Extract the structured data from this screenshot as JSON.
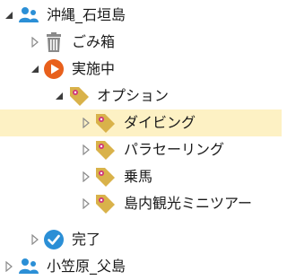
{
  "tree": {
    "nodes": [
      {
        "label": "沖縄_石垣島",
        "icon": "user-group-icon",
        "expanded": true,
        "selected": false
      },
      {
        "label": "ごみ箱",
        "icon": "trash-icon",
        "expanded": false,
        "selected": false
      },
      {
        "label": "実施中",
        "icon": "play-circle-icon",
        "expanded": true,
        "selected": false
      },
      {
        "label": "オプション",
        "icon": "tag-icon",
        "expanded": true,
        "selected": false
      },
      {
        "label": "ダイビング",
        "icon": "tag-icon",
        "expanded": false,
        "selected": true
      },
      {
        "label": "パラセーリング",
        "icon": "tag-icon",
        "expanded": false,
        "selected": false
      },
      {
        "label": "乗馬",
        "icon": "tag-icon",
        "expanded": false,
        "selected": false
      },
      {
        "label": "島内観光ミニツアー",
        "icon": "tag-icon",
        "expanded": false,
        "selected": false
      },
      {
        "label": "完了",
        "icon": "check-circle-icon",
        "expanded": false,
        "selected": false
      },
      {
        "label": "小笠原_父島",
        "icon": "user-group-icon",
        "expanded": false,
        "selected": false
      }
    ]
  },
  "colors": {
    "selection": "#fdf1c4",
    "user_icon": "#2b8fd6",
    "play_icon": "#e8601c",
    "check_icon": "#2b8fd6",
    "tag_icon": "#d9b24a",
    "tag_dot": "#d0367a",
    "trash_icon": "#8a8a8a"
  }
}
